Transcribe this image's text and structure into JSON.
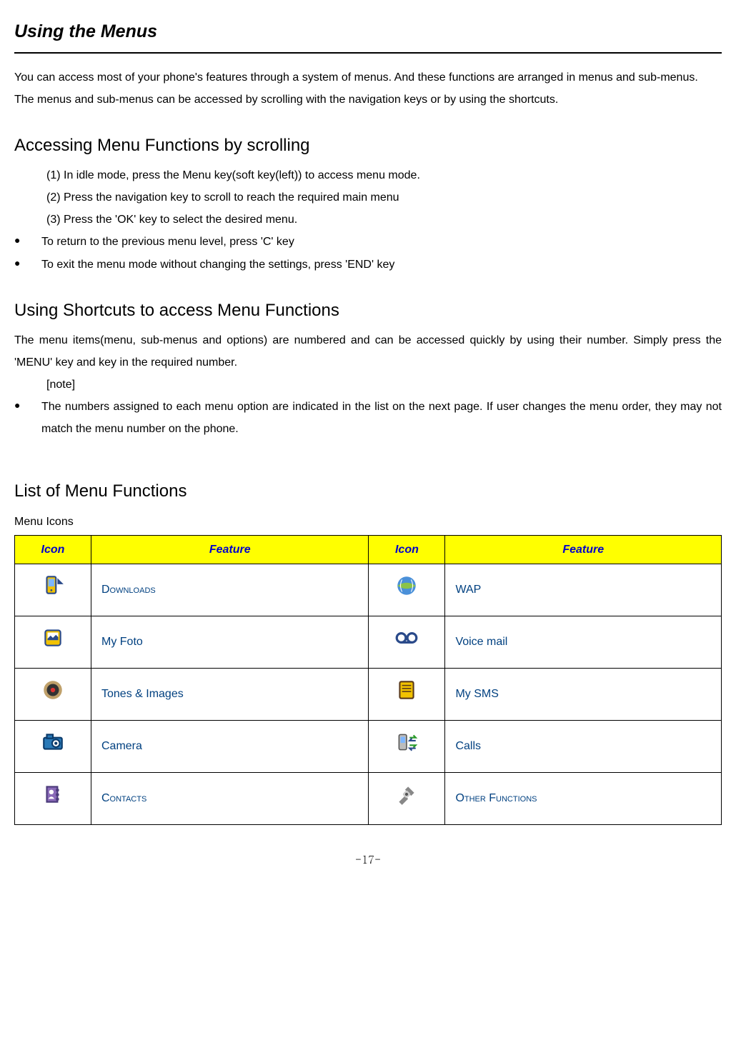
{
  "title": "Using the Menus",
  "intro_p1": "You can access most of your phone's features through a system of menus. And these functions are arranged in menus and sub-menus.",
  "intro_p2": "The menus and sub-menus can be accessed by scrolling with the navigation keys or by using the shortcuts.",
  "section1": {
    "heading": "Accessing Menu Functions by scrolling",
    "step1": "(1) In idle mode, press the Menu key(soft key(left)) to access menu mode.",
    "step2": "(2) Press the navigation key to scroll to reach the required main menu",
    "step3": "(3) Press the 'OK' key to select the desired menu.",
    "bullet1": "To return to the previous menu level, press 'C' key",
    "bullet2": "To exit the menu mode without changing the settings, press 'END' key"
  },
  "section2": {
    "heading": "Using Shortcuts to access Menu Functions",
    "body": "The menu items(menu, sub-menus and options) are numbered and can be accessed quickly by using their number. Simply press the 'MENU' key and key in the required number.",
    "note_label": "[note]",
    "note_bullet": "The numbers assigned to each menu option are indicated in the list on the next page. If user changes the menu order, they may not match the menu number on the phone."
  },
  "section3": {
    "heading": "List of Menu Functions",
    "sub": "Menu Icons",
    "headers": {
      "icon": "Icon",
      "feature": "Feature"
    },
    "rows": [
      {
        "f1": "Downloads",
        "f1_sc": true,
        "f2": "WAP",
        "f2_sc": false
      },
      {
        "f1": "My Foto",
        "f1_sc": false,
        "f2": "Voice mail",
        "f2_sc": false
      },
      {
        "f1": "Tones & Images",
        "f1_sc": false,
        "f2": "My SMS",
        "f2_sc": false
      },
      {
        "f1": "Camera",
        "f1_sc": false,
        "f2": "Calls",
        "f2_sc": false
      },
      {
        "f1": "Contacts",
        "f1_sc": true,
        "f2": "Other Functions",
        "f2_sc": true
      }
    ]
  },
  "page_number": "-17-"
}
